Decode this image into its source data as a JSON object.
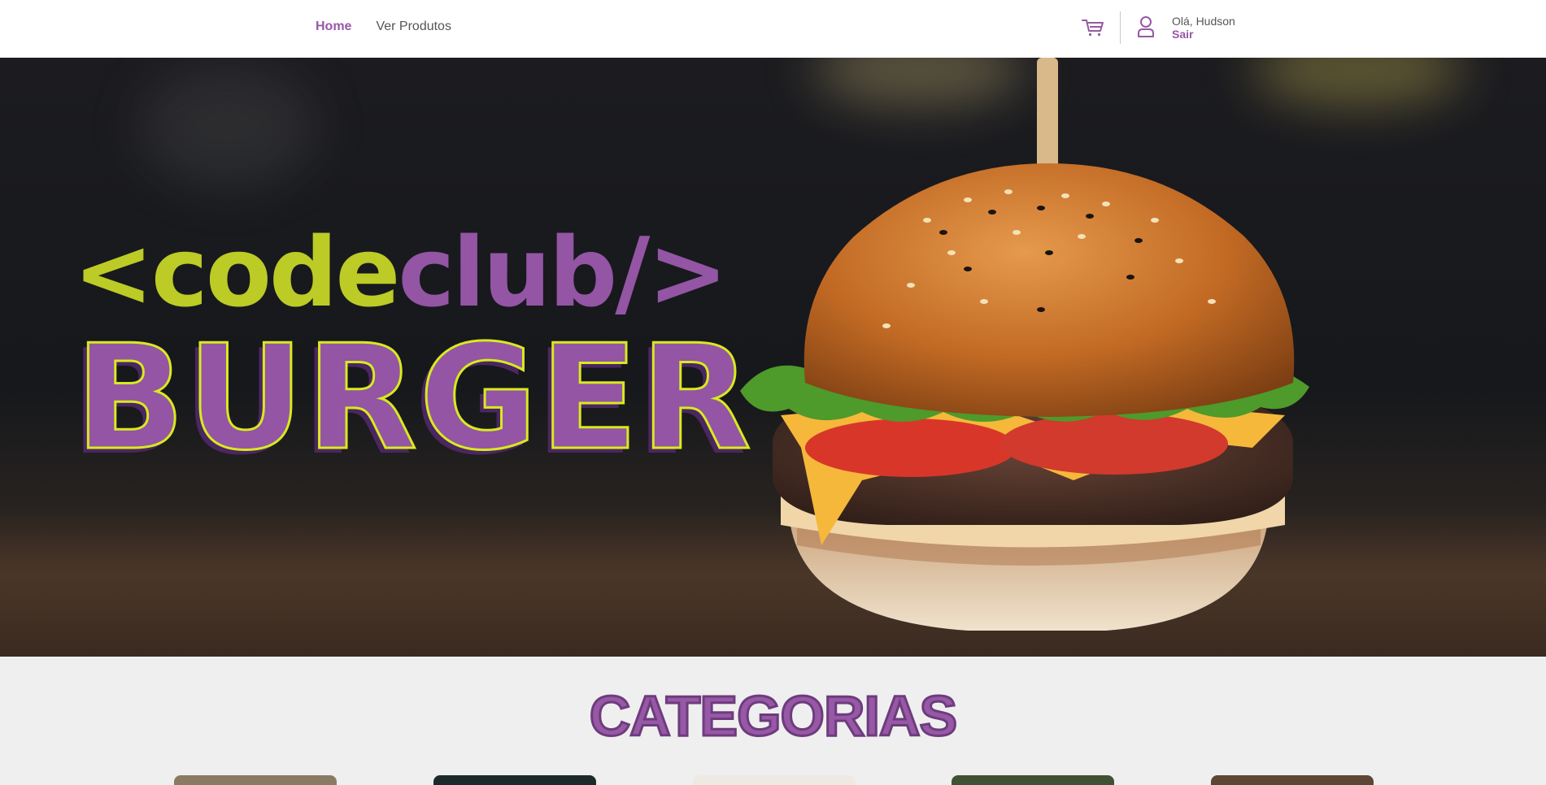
{
  "nav": {
    "items": [
      {
        "label": "Home",
        "active": true
      },
      {
        "label": "Ver Produtos",
        "active": false
      }
    ]
  },
  "user": {
    "greeting": "Olá, Hudson",
    "logout": "Sair"
  },
  "icons": {
    "cart": "cart-icon",
    "user": "user-icon"
  },
  "hero": {
    "logo_code": "<code",
    "logo_club": "club/>",
    "logo_burger": "BURGER"
  },
  "categories": {
    "title": "CATEGORIAS",
    "cards": [
      {
        "color": "#8b7a63"
      },
      {
        "color": "#1c2a2c"
      },
      {
        "color": "#efe9e4"
      },
      {
        "color": "#3f5234"
      },
      {
        "color": "#5e4634"
      }
    ]
  },
  "colors": {
    "accent": "#9758a6",
    "logo_green": "#bccb26",
    "logo_purple": "#9355a4"
  }
}
